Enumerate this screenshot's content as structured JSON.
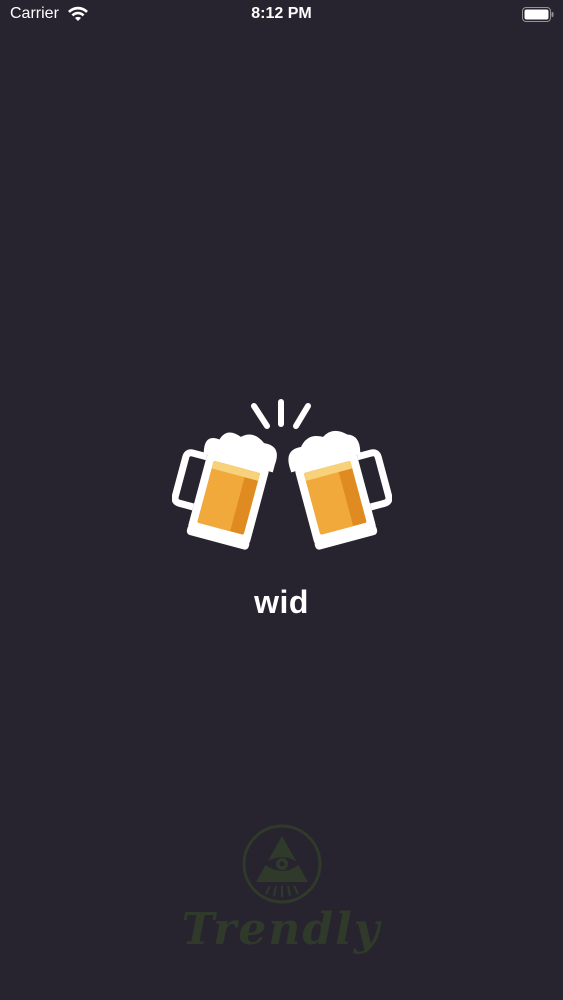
{
  "status_bar": {
    "carrier": "Carrier",
    "time": "8:12 PM",
    "wifi_icon": "wifi-icon",
    "battery_icon": "battery-icon"
  },
  "splash": {
    "app_name": "wid",
    "logo_icon": "cheers-beer-mugs-icon"
  },
  "brand": {
    "wordmark": "Trendly",
    "emblem_icon": "eye-triangle-emblem-icon"
  },
  "colors": {
    "background": "#27242f",
    "beer": "#f2a93b",
    "beer_dark": "#e08b22",
    "outline": "#ffffff",
    "brand_green": "#2f3a2a"
  }
}
